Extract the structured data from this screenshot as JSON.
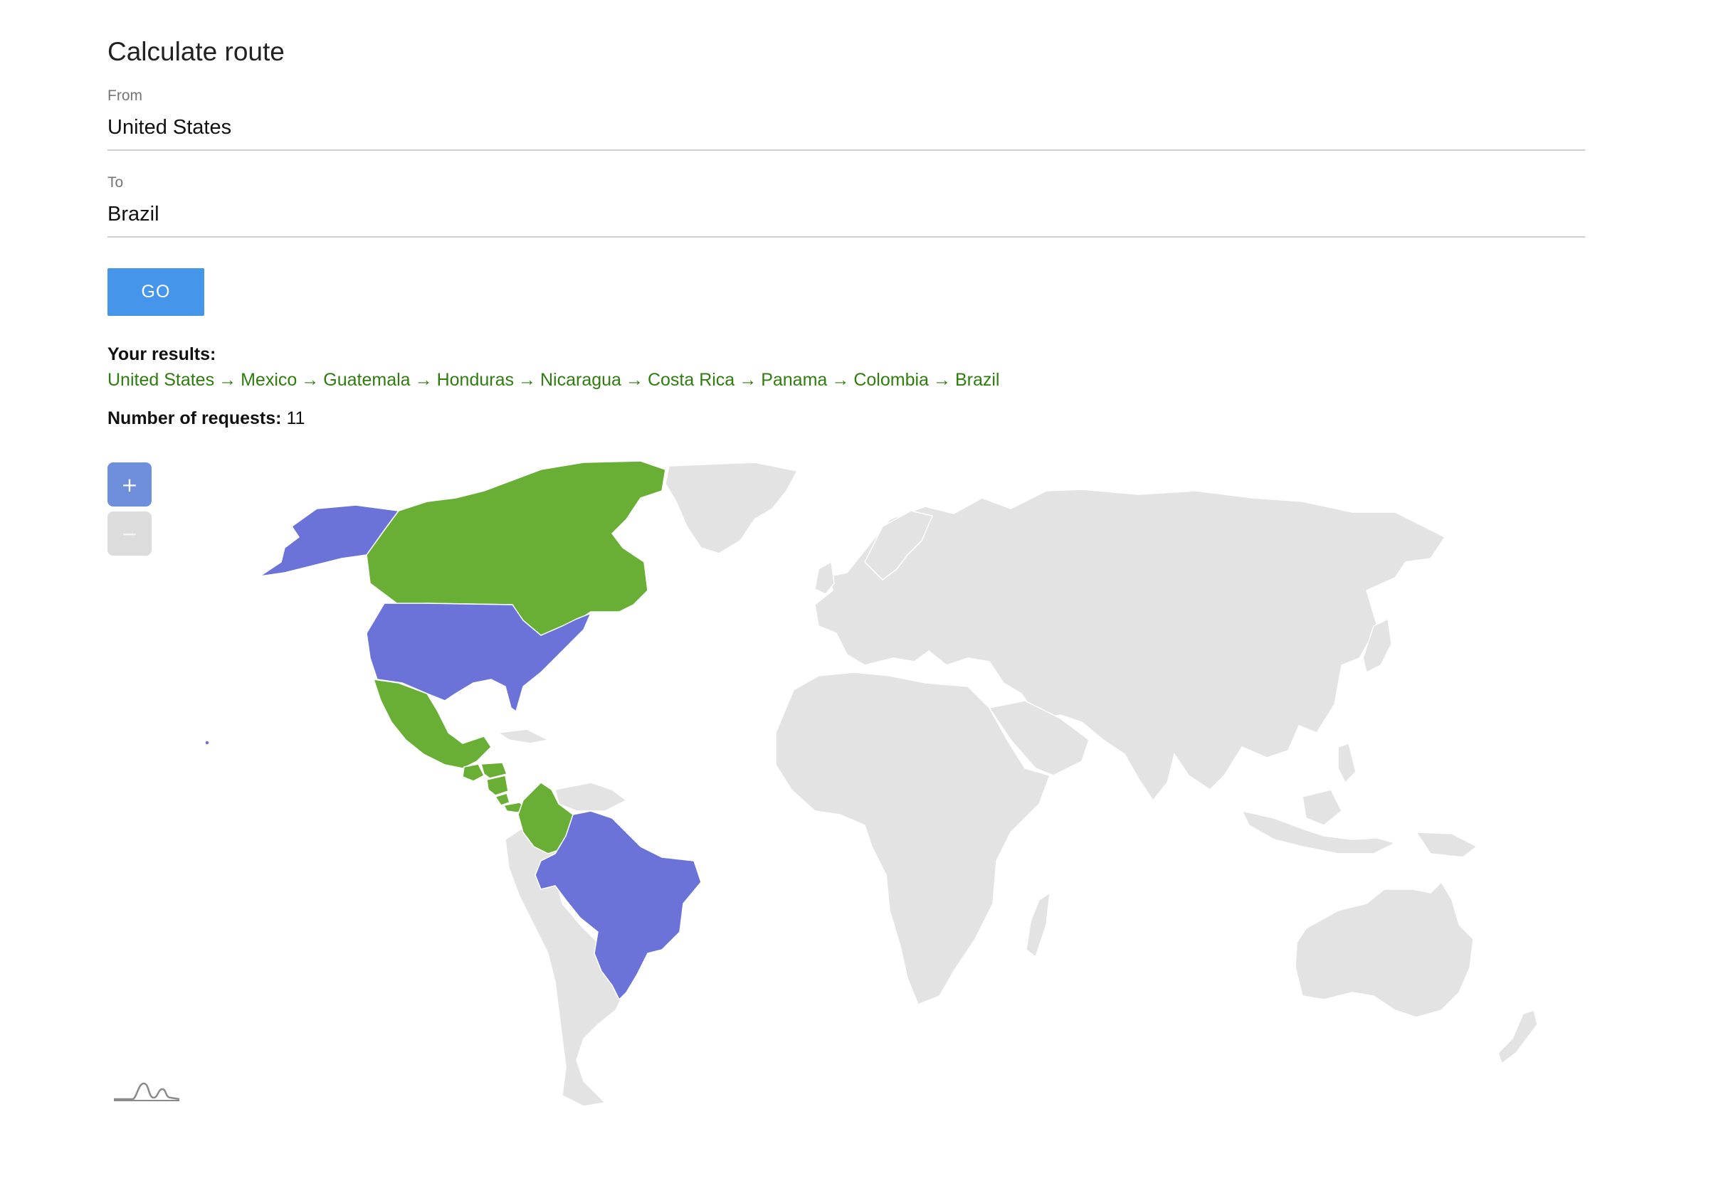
{
  "page": {
    "title": "Calculate route"
  },
  "form": {
    "from_label": "From",
    "from_value": "United States",
    "to_label": "To",
    "to_value": "Brazil",
    "go_label": "GO"
  },
  "results": {
    "heading": "Your results:",
    "route": [
      "United States",
      "Mexico",
      "Guatemala",
      "Honduras",
      "Nicaragua",
      "Costa Rica",
      "Panama",
      "Colombia",
      "Brazil"
    ],
    "arrow": "→",
    "requests_label": "Number of requests:",
    "requests_value": "11"
  },
  "map": {
    "zoom_in_label": "+",
    "zoom_out_label": "−",
    "endpoint_countries": [
      "United States",
      "Brazil"
    ],
    "path_countries": [
      "Canada",
      "Mexico",
      "Guatemala",
      "Honduras",
      "Nicaragua",
      "Costa Rica",
      "Panama",
      "Colombia"
    ],
    "colors": {
      "endpoint": "#6b73d9",
      "path": "#6aaf35",
      "land": "#e3e3e3",
      "borders": "#ffffff"
    },
    "logo_icon": "amcharts-logo-icon"
  }
}
